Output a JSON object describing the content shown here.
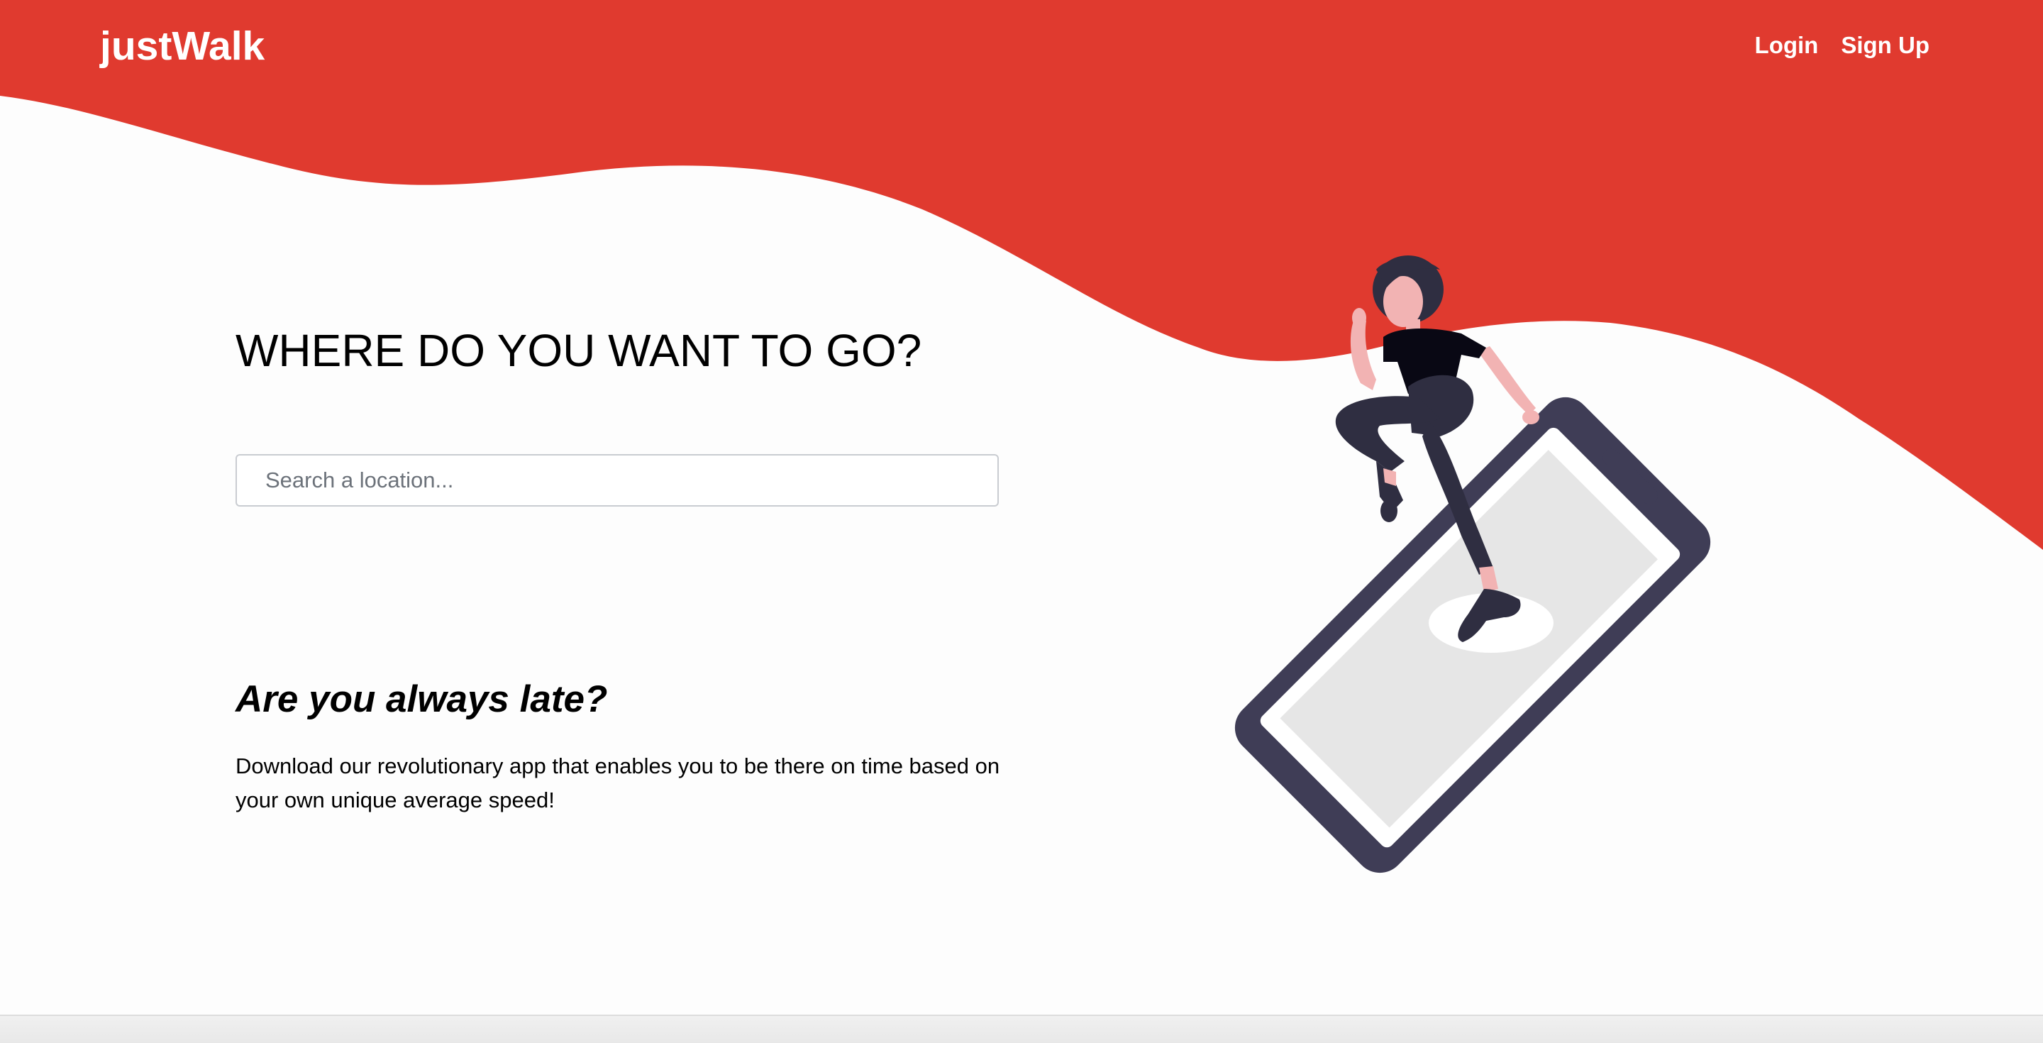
{
  "header": {
    "brand": "justWalk",
    "nav": {
      "login_label": "Login",
      "signup_label": "Sign Up"
    }
  },
  "hero": {
    "title": "WHERE DO YOU WANT TO GO?",
    "search": {
      "placeholder": "Search a location...",
      "value": ""
    }
  },
  "promo": {
    "title": "Are you always late?",
    "description": "Download our revolutionary app that enables you to be there on time based on your own unique average speed!"
  },
  "colors": {
    "accent": "#e03a2f",
    "background": "#fdfdfd",
    "phone_frame": "#3f3d56",
    "phone_screen": "#e6e6e6",
    "skin": "#f2b3b3",
    "clothing": "#2f2e41"
  },
  "illustration": {
    "icon": "woman-walking-on-phone-illustration"
  }
}
